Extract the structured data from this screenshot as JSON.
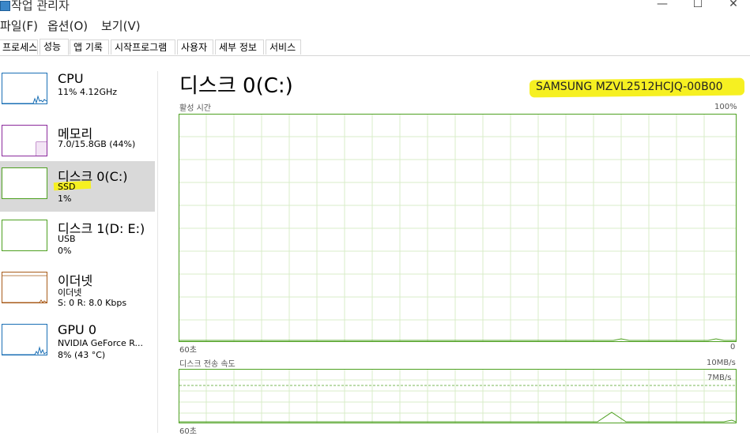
{
  "window": {
    "title": "작업 관리자",
    "minimize": "—",
    "maximize": "☐",
    "close": "✕"
  },
  "menu": [
    "파일(F)",
    "옵션(O)",
    "보기(V)"
  ],
  "tabs": [
    "프로세스",
    "성능",
    "앱 기록",
    "시작프로그램",
    "사용자",
    "세부 정보",
    "서비스"
  ],
  "active_tab": "성능",
  "sidebar": {
    "items": [
      {
        "name": "CPU",
        "line1": "11% 4.12GHz",
        "line2": "",
        "color": "#1a6fb5"
      },
      {
        "name": "메모리",
        "line1": "7.0/15.8GB (44%)",
        "line2": "",
        "color": "#8b2a9c"
      },
      {
        "name": "디스크 0(C:)",
        "line1": "SSD",
        "line2": "1%",
        "color": "#4da020",
        "selected": true,
        "line1_highlight": true
      },
      {
        "name": "디스크 1(D: E:)",
        "line1": "USB",
        "line2": "0%",
        "color": "#4da020"
      },
      {
        "name": "이더넷",
        "line1": "이더넷",
        "line2": "S: 0 R: 8.0 Kbps",
        "color": "#a85b1a"
      },
      {
        "name": "GPU 0",
        "line1": "NVIDIA GeForce R...",
        "line2": "8% (43 °C)",
        "color": "#1a6fb5"
      }
    ]
  },
  "main": {
    "title": "디스크 0(C:)",
    "model": "SAMSUNG MZVL2512HCJQ-00B00",
    "active_time": {
      "label": "활성 시간",
      "max_label": "100%",
      "time_label": "60초",
      "zero_label": "0"
    },
    "transfer_rate": {
      "label": "디스크 전송 속도",
      "max_label": "10MB/s",
      "sub_label": "7MB/s",
      "time_label": "60초"
    },
    "graph_color": "#4da020",
    "grid_color": "#d8ecc8"
  }
}
